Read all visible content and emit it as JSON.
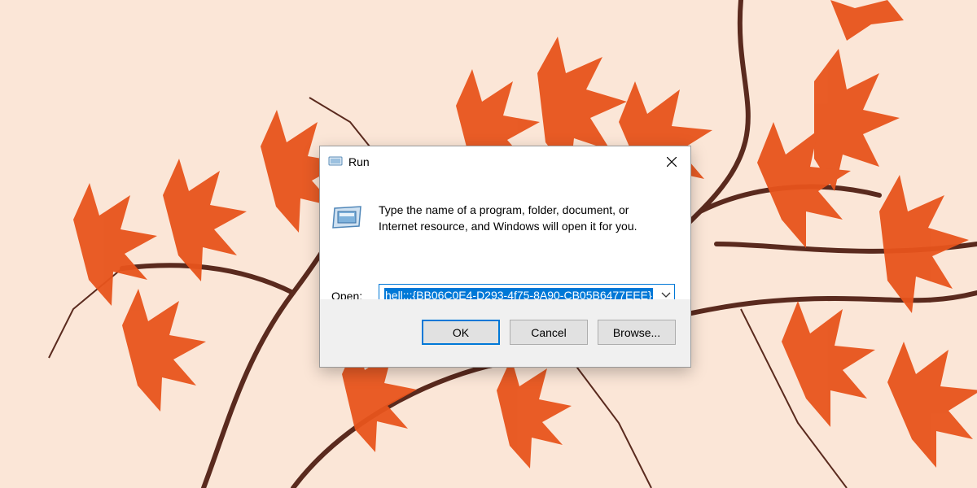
{
  "dialog": {
    "title": "Run",
    "description_line1": "Type the name of a program, folder, document, or",
    "description_line2": "Internet resource, and Windows will open it for you.",
    "open_label": "Open:",
    "open_value": "hell:::{BB06C0E4-D293-4f75-8A90-CB05B6477EEE}",
    "buttons": {
      "ok": "OK",
      "cancel": "Cancel",
      "browse": "Browse..."
    }
  },
  "icons": {
    "title": "run-icon",
    "app": "run-app-icon",
    "close": "close-icon",
    "dropdown": "chevron-down-icon"
  },
  "colors": {
    "accent": "#0078d7",
    "wallpaper": "#fbe6d7",
    "leaves": "#e8541c",
    "branches": "#5a2a1e"
  }
}
